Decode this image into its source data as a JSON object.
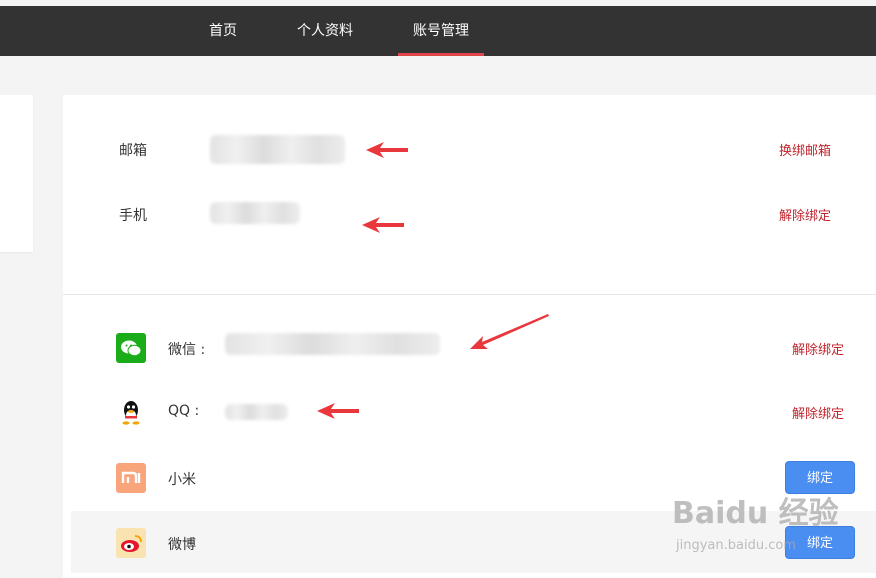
{
  "nav": {
    "items": [
      "首页",
      "个人资料",
      "账号管理"
    ],
    "active": "账号管理"
  },
  "account": {
    "email_label": "邮箱",
    "email_action": "换绑邮箱",
    "phone_label": "手机",
    "phone_action": "解除绑定"
  },
  "social": [
    {
      "name": "微信 :",
      "action": "解除绑定",
      "icon": "wechat-icon",
      "color": "#1aad19"
    },
    {
      "name": "QQ :",
      "action": "解除绑定",
      "icon": "qq-icon",
      "color": "#000000"
    },
    {
      "name": "小米",
      "action": "绑定",
      "icon": "xiaomi-icon",
      "color": "#f8a57c"
    },
    {
      "name": "微博",
      "action": "绑定",
      "icon": "weibo-icon",
      "color": "#e6162d"
    }
  ],
  "watermark": {
    "brand": "Baidu 经验",
    "url": "jingyan.baidu.com"
  },
  "colors": {
    "nav_bg": "#333333",
    "active_underline": "#e0454c",
    "link": "#c0242d",
    "button": "#4b8ef1"
  }
}
